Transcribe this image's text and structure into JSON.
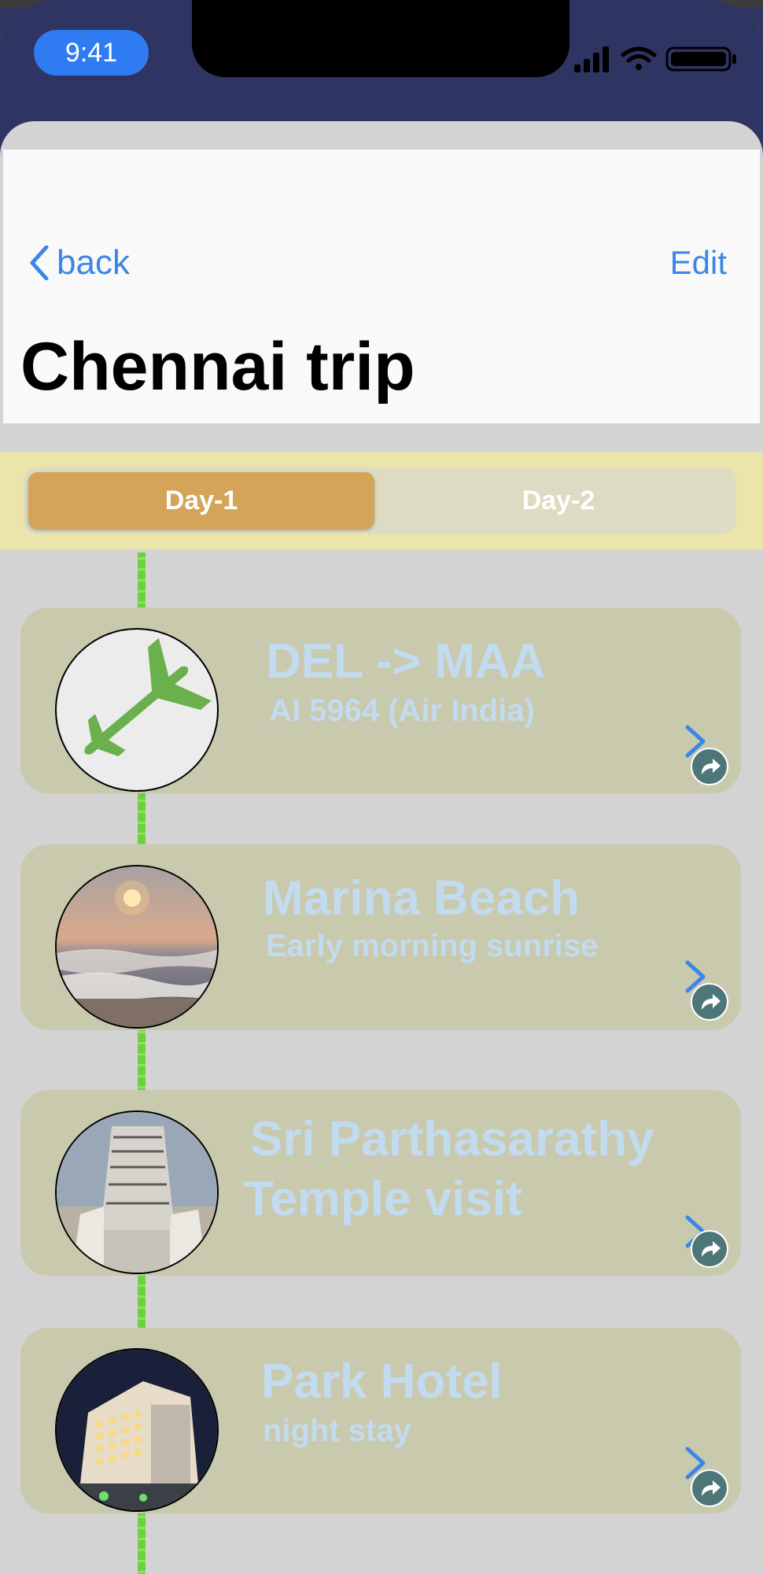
{
  "status_bar": {
    "time": "9:41"
  },
  "nav": {
    "back_label": "back",
    "edit_label": "Edit",
    "title": "Chennai trip"
  },
  "segments": [
    {
      "label": "Day-1",
      "selected": true
    },
    {
      "label": "Day-2",
      "selected": false
    }
  ],
  "items": [
    {
      "title": "DEL  -> MAA",
      "subtitle": "AI 5964 (Air India)",
      "icon": "airplane-icon"
    },
    {
      "title": "Marina Beach",
      "subtitle": "Early morning sunrise",
      "icon": "beach-sunrise-photo"
    },
    {
      "title": "Sri Parthasarathy",
      "title_line2": "Temple visit",
      "icon": "temple-photo"
    },
    {
      "title": "Park Hotel",
      "subtitle": "night stay",
      "icon": "hotel-photo"
    }
  ],
  "colors": {
    "accent": "#3b86e6",
    "segment_active": "#d4a458",
    "card_bg": "#c9c9ae",
    "card_text": "#c2dbef",
    "timeline": "#6cd13e"
  }
}
